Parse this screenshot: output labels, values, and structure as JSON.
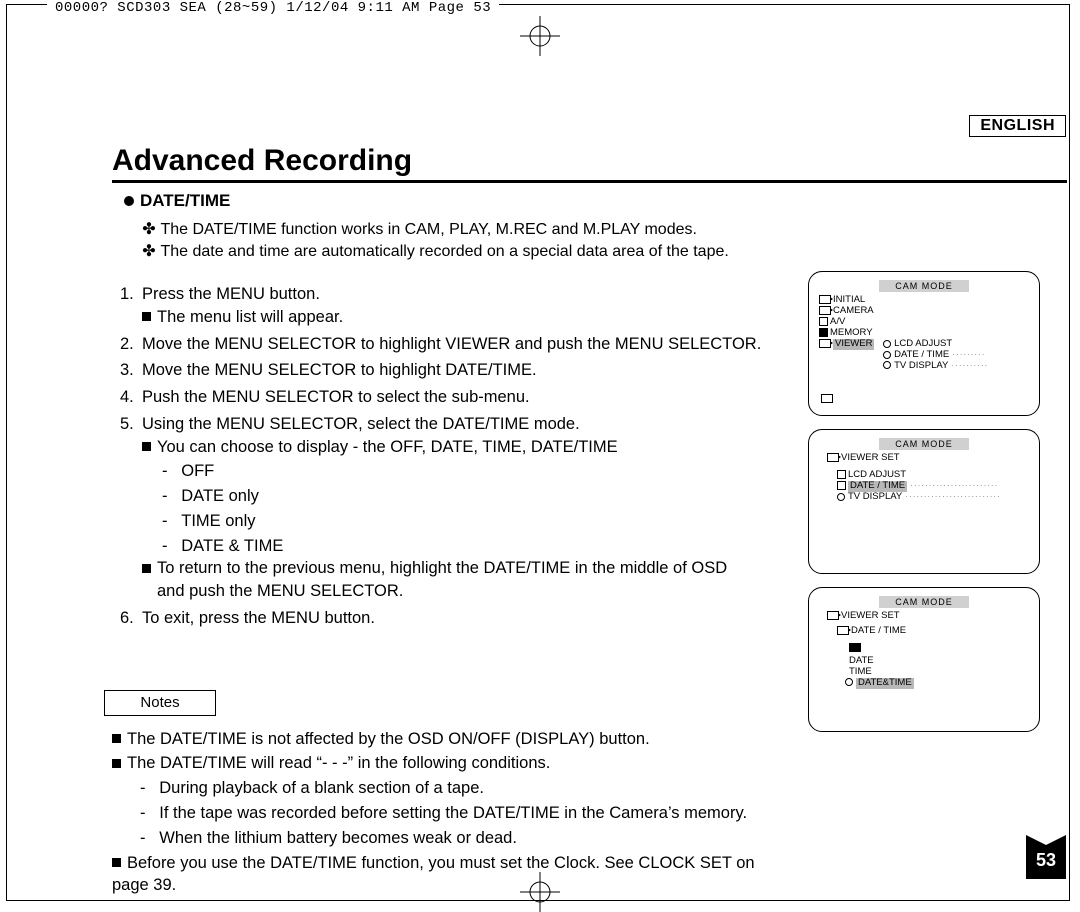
{
  "crop_header": "00000? SCD303 SEA (28~59)  1/12/04 9:11 AM  Page 53",
  "language": "ENGLISH",
  "title": "Advanced Recording",
  "subheading": "DATE/TIME",
  "intro": [
    "The DATE/TIME function works in CAM, PLAY, M.REC and M.PLAY modes.",
    "The date and time are automatically recorded on a special data area of the tape."
  ],
  "steps": {
    "s1": "Press the MENU button.",
    "s1a": "The menu list will appear.",
    "s2": "Move the MENU SELECTOR to highlight VIEWER and push the MENU SELECTOR.",
    "s3": "Move the MENU SELECTOR to highlight DATE/TIME.",
    "s4": "Push the MENU SELECTOR to select the sub-menu.",
    "s5": "Using the MENU SELECTOR, select the DATE/TIME mode.",
    "s5a": "You can choose to display - the OFF, DATE, TIME, DATE/TIME",
    "s5o1": "OFF",
    "s5o2": "DATE only",
    "s5o3": "TIME only",
    "s5o4": "DATE & TIME",
    "s5b_1": "To return to the previous menu, highlight the DATE/TIME in the middle of OSD",
    "s5b_2": "and push the MENU SELECTOR.",
    "s6": "To exit, press the MENU button."
  },
  "notes_label": "Notes",
  "notes": {
    "n1": "The DATE/TIME is not affected by the OSD ON/OFF (DISPLAY) button.",
    "n2": "The DATE/TIME will read “- - -” in the following conditions.",
    "n2a": "During playback of a blank section of a tape.",
    "n2b": "If the tape was recorded before setting the DATE/TIME in the Camera’s memory.",
    "n2c": "When the lithium battery becomes weak or dead.",
    "n3": "Before you use the DATE/TIME function, you must set the Clock. See CLOCK SET on page 39."
  },
  "fig1": {
    "header": "CAM  MODE",
    "initial": "INITIAL",
    "camera": "CAMERA",
    "av": "A/V",
    "memory": "MEMORY",
    "viewer": "VIEWER",
    "lcd": "LCD ADJUST",
    "date": "DATE / TIME",
    "tv": "TV DISPLAY"
  },
  "fig2": {
    "header": "CAM  MODE",
    "set": "VIEWER SET",
    "lcd": "LCD ADJUST",
    "date": "DATE / TIME",
    "tv": "TV DISPLAY"
  },
  "fig3": {
    "header": "CAM  MODE",
    "set": "VIEWER SET",
    "date_h": "DATE / TIME",
    "date": "DATE",
    "time": "TIME",
    "dt": "DATE&TIME"
  },
  "page_number": "53"
}
